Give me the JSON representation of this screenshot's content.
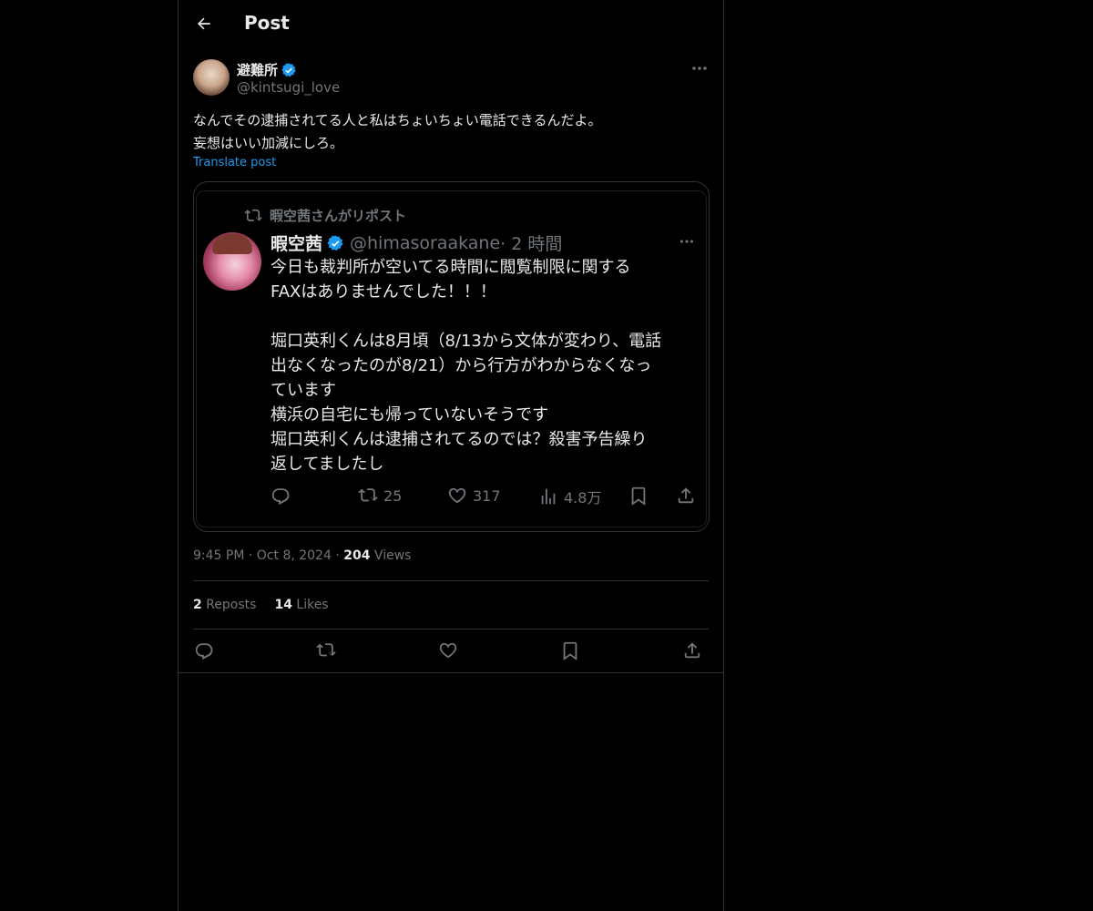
{
  "header": {
    "title": "Post",
    "back_icon": "arrow-left-icon"
  },
  "post": {
    "author_name": "避難所",
    "author_handle": "@kintsugi_love",
    "text": "なんでその逮捕されてる人と私はちょいちょい電話できるんだよ。\n妄想はいい加減にしろ。",
    "translate_label": "Translate post",
    "time": "9:45 PM",
    "date": "Oct 8, 2024",
    "views_count": "204",
    "views_label": "Views",
    "reposts_count": "2",
    "reposts_label": "Reposts",
    "likes_count": "14",
    "likes_label": "Likes"
  },
  "quote": {
    "repost_by": "暇空茜さんがリポスト",
    "name": "暇空茜",
    "handle": "@himasoraakane",
    "time": "· 2 時間",
    "text": "今日も裁判所が空いてる時間に閲覧制限に関する\nFAXはありませんでした！！！\n\n堀口英利くんは8月頃（8/13から文体が変わり、電話\n出なくなったのが8/21）から行方がわからなくなっ\nています\n横浜の自宅にも帰っていないそうです\n堀口英利くんは逮捕されてるのでは？殺害予告繰り\n返してましたし",
    "retweets": "25",
    "likes": "317",
    "views": "4.8万"
  },
  "colors": {
    "background": "#000000",
    "text": "#e7e9ea",
    "muted": "#71767b",
    "accent": "#1d9bf0",
    "border": "#2f3336"
  }
}
